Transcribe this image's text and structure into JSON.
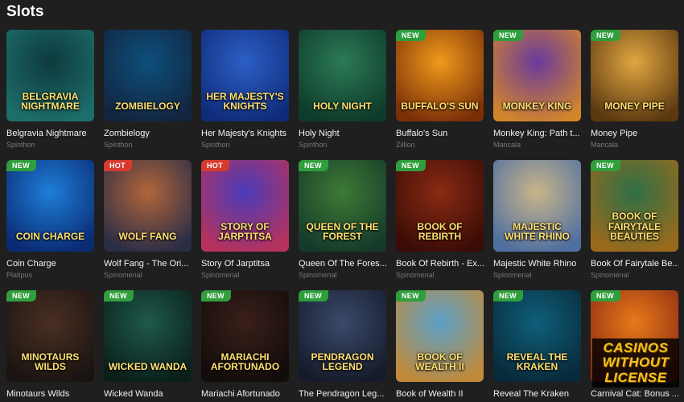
{
  "section": {
    "title": "Slots"
  },
  "games": [
    {
      "name": "Belgravia Nightmare",
      "provider": "Spinthon",
      "badge": "",
      "logo": "Belgravia Nightmare",
      "colors": [
        "#0e3a3f",
        "#1c6e6a"
      ]
    },
    {
      "name": "Zombielogy",
      "provider": "Spinthon",
      "badge": "",
      "logo": "Zombielogy",
      "colors": [
        "#0d4f7c",
        "#12253f"
      ]
    },
    {
      "name": "Her Majesty's Knights",
      "provider": "Spinthon",
      "badge": "",
      "logo": "Her Majesty's Knights",
      "colors": [
        "#2c5fc6",
        "#0f2c7a"
      ]
    },
    {
      "name": "Holy Night",
      "provider": "Spinthon",
      "badge": "",
      "logo": "Holy Night",
      "colors": [
        "#2b7a56",
        "#0e3b2a"
      ]
    },
    {
      "name": "Buffalo's Sun",
      "provider": "Zillion",
      "badge": "NEW",
      "logo": "Buffalo's Sun",
      "colors": [
        "#f09a1b",
        "#7a2f08"
      ]
    },
    {
      "name": "Monkey King: Path t...",
      "provider": "Mancala",
      "badge": "NEW",
      "logo": "Monkey King",
      "colors": [
        "#6a3a9c",
        "#d3852b"
      ]
    },
    {
      "name": "Money Pipe",
      "provider": "Mancala",
      "badge": "NEW",
      "logo": "Money Pipe",
      "colors": [
        "#e0a640",
        "#5b3810"
      ]
    },
    {
      "name": "Coin Charge",
      "provider": "Platipus",
      "badge": "NEW",
      "logo": "Coin Charge",
      "colors": [
        "#1e7ed8",
        "#0a2b73"
      ]
    },
    {
      "name": "Wolf Fang - The Ori...",
      "provider": "Spinomenal",
      "badge": "HOT",
      "logo": "Wolf Fang",
      "colors": [
        "#b2653a",
        "#2a2d46"
      ]
    },
    {
      "name": "Story Of Jarptitsa",
      "provider": "Spinomenal",
      "badge": "HOT",
      "logo": "Story of Jarptitsa",
      "colors": [
        "#4b3bb8",
        "#b6325c"
      ]
    },
    {
      "name": "Queen Of The Fores...",
      "provider": "Spinomenal",
      "badge": "NEW",
      "logo": "Queen of the Forest",
      "colors": [
        "#3d7a35",
        "#153a2a"
      ]
    },
    {
      "name": "Book Of Rebirth - Ex...",
      "provider": "Spinomenal",
      "badge": "NEW",
      "logo": "Book of Rebirth",
      "colors": [
        "#8a2a12",
        "#3a0c06"
      ]
    },
    {
      "name": "Majestic White Rhino",
      "provider": "Spinomenal",
      "badge": "",
      "logo": "Majestic White Rhino",
      "colors": [
        "#c9b58a",
        "#4f6fa0"
      ]
    },
    {
      "name": "Book Of Fairytale Be...",
      "provider": "Spinomenal",
      "badge": "NEW",
      "logo": "Book of Fairytale Beauties",
      "colors": [
        "#2e6f47",
        "#9a6a1c"
      ]
    },
    {
      "name": "Minotaurs Wilds",
      "provider": "",
      "badge": "NEW",
      "logo": "Minotaurs Wilds",
      "colors": [
        "#4a2f22",
        "#1a1412"
      ]
    },
    {
      "name": "Wicked Wanda",
      "provider": "",
      "badge": "NEW",
      "logo": "Wicked Wanda",
      "colors": [
        "#1f5a4a",
        "#0a1e1a"
      ]
    },
    {
      "name": "Mariachi Afortunado",
      "provider": "",
      "badge": "NEW",
      "logo": "Mariachi Afortunado",
      "colors": [
        "#3a1f1a",
        "#120c0a"
      ]
    },
    {
      "name": "The Pendragon Leg...",
      "provider": "",
      "badge": "NEW",
      "logo": "Pendragon Legend",
      "colors": [
        "#3b4a6a",
        "#151b2b"
      ]
    },
    {
      "name": "Book of Wealth II",
      "provider": "",
      "badge": "NEW",
      "logo": "Book of Wealth II",
      "colors": [
        "#5aa0c8",
        "#c28a3a"
      ]
    },
    {
      "name": "Reveal The Kraken",
      "provider": "",
      "badge": "NEW",
      "logo": "Reveal the Kraken",
      "colors": [
        "#0f5f7a",
        "#082a3a"
      ]
    },
    {
      "name": "Carnival Cat: Bonus ...",
      "provider": "",
      "badge": "NEW",
      "logo": "",
      "colors": [
        "#e87a1a",
        "#8a2a12"
      ]
    }
  ],
  "watermark": {
    "line1": "CASINOS",
    "line2": "WITHOUT",
    "line3": "LICENSE"
  }
}
